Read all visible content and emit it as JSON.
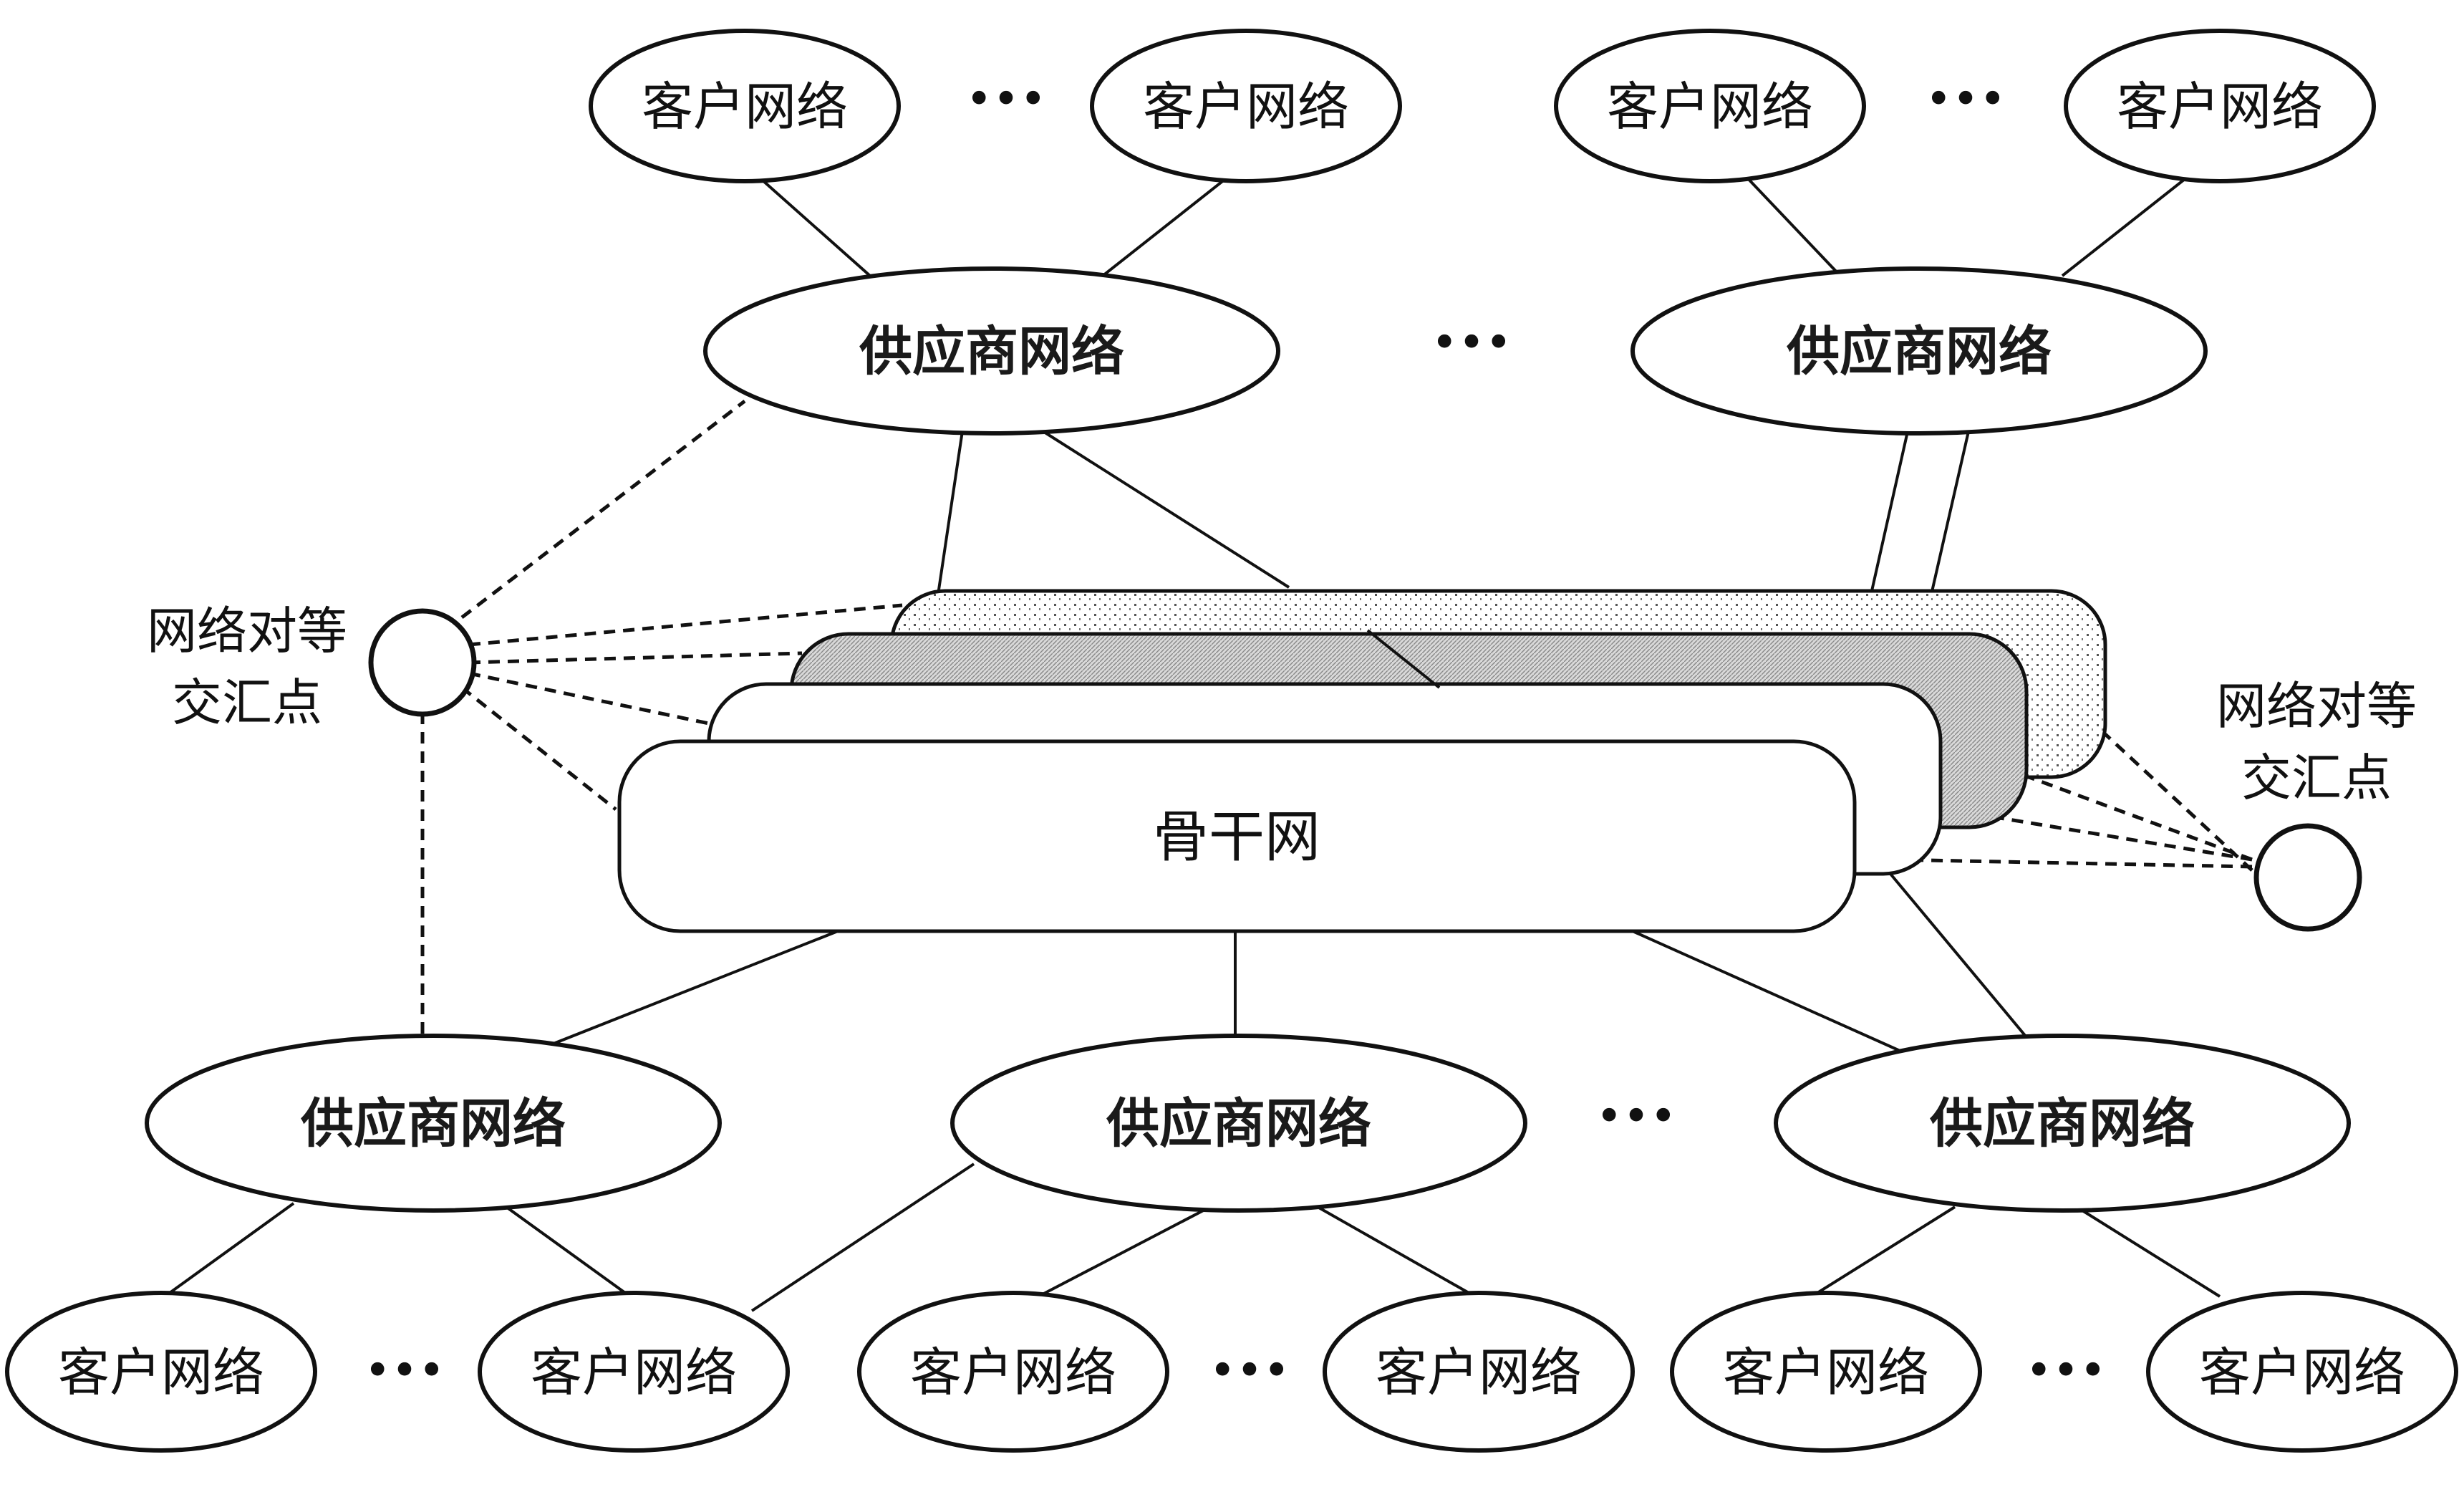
{
  "client_label": "客户网络",
  "provider_label": "供应商网络",
  "backbone_label": "骨干网",
  "ixp_label_line1": "网络对等",
  "ixp_label_line2": "交汇点",
  "ellipsis": "•••",
  "colors": {
    "stroke": "#111111",
    "fill": "#ffffff",
    "hatch": "#bcbcbc"
  }
}
